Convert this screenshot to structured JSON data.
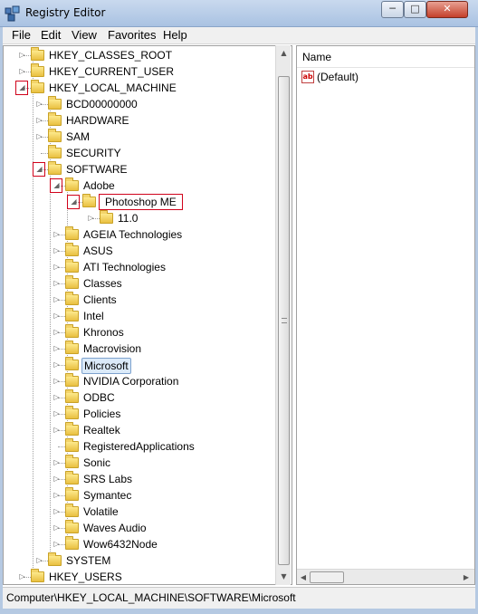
{
  "window": {
    "title": "Registry Editor",
    "controls": {
      "minimize": "─",
      "maximize": "□",
      "close": "✕"
    }
  },
  "menu": [
    "File",
    "Edit",
    "View",
    "Favorites",
    "Help"
  ],
  "tree": [
    {
      "label": "HKEY_CLASSES_ROOT",
      "depth": 0,
      "state": "collapsed"
    },
    {
      "label": "HKEY_CURRENT_USER",
      "depth": 0,
      "state": "collapsed"
    },
    {
      "label": "HKEY_LOCAL_MACHINE",
      "depth": 0,
      "state": "expanded",
      "highlighted": true
    },
    {
      "label": "BCD00000000",
      "depth": 1,
      "state": "collapsed"
    },
    {
      "label": "HARDWARE",
      "depth": 1,
      "state": "collapsed"
    },
    {
      "label": "SAM",
      "depth": 1,
      "state": "collapsed"
    },
    {
      "label": "SECURITY",
      "depth": 1,
      "state": "none"
    },
    {
      "label": "SOFTWARE",
      "depth": 1,
      "state": "expanded",
      "highlighted": true
    },
    {
      "label": "Adobe",
      "depth": 2,
      "state": "expanded",
      "highlighted": true
    },
    {
      "label": "Photoshop ME",
      "depth": 3,
      "state": "expanded",
      "highlighted": true,
      "label_boxed": true
    },
    {
      "label": "11.0",
      "depth": 4,
      "state": "collapsed"
    },
    {
      "label": "AGEIA Technologies",
      "depth": 2,
      "state": "collapsed"
    },
    {
      "label": "ASUS",
      "depth": 2,
      "state": "collapsed"
    },
    {
      "label": "ATI Technologies",
      "depth": 2,
      "state": "collapsed"
    },
    {
      "label": "Classes",
      "depth": 2,
      "state": "collapsed"
    },
    {
      "label": "Clients",
      "depth": 2,
      "state": "collapsed"
    },
    {
      "label": "Intel",
      "depth": 2,
      "state": "collapsed"
    },
    {
      "label": "Khronos",
      "depth": 2,
      "state": "collapsed"
    },
    {
      "label": "Macrovision",
      "depth": 2,
      "state": "collapsed"
    },
    {
      "label": "Microsoft",
      "depth": 2,
      "state": "collapsed",
      "selected": true
    },
    {
      "label": "NVIDIA Corporation",
      "depth": 2,
      "state": "collapsed"
    },
    {
      "label": "ODBC",
      "depth": 2,
      "state": "collapsed"
    },
    {
      "label": "Policies",
      "depth": 2,
      "state": "collapsed"
    },
    {
      "label": "Realtek",
      "depth": 2,
      "state": "collapsed"
    },
    {
      "label": "RegisteredApplications",
      "depth": 2,
      "state": "none"
    },
    {
      "label": "Sonic",
      "depth": 2,
      "state": "collapsed"
    },
    {
      "label": "SRS Labs",
      "depth": 2,
      "state": "collapsed"
    },
    {
      "label": "Symantec",
      "depth": 2,
      "state": "collapsed"
    },
    {
      "label": "Volatile",
      "depth": 2,
      "state": "collapsed"
    },
    {
      "label": "Waves Audio",
      "depth": 2,
      "state": "collapsed"
    },
    {
      "label": "Wow6432Node",
      "depth": 2,
      "state": "collapsed"
    },
    {
      "label": "SYSTEM",
      "depth": 1,
      "state": "collapsed"
    },
    {
      "label": "HKEY_USERS",
      "depth": 0,
      "state": "collapsed"
    }
  ],
  "list": {
    "column_header": "Name",
    "rows": [
      {
        "icon": "string-value-icon",
        "icon_text": "ab",
        "name": "(Default)"
      }
    ]
  },
  "statusbar": {
    "path": "Computer\\HKEY_LOCAL_MACHINE\\SOFTWARE\\Microsoft"
  },
  "colors": {
    "highlight_border": "#d0021b",
    "selection_bg": "#dbeaf9",
    "frame": "#b5c9e2"
  }
}
